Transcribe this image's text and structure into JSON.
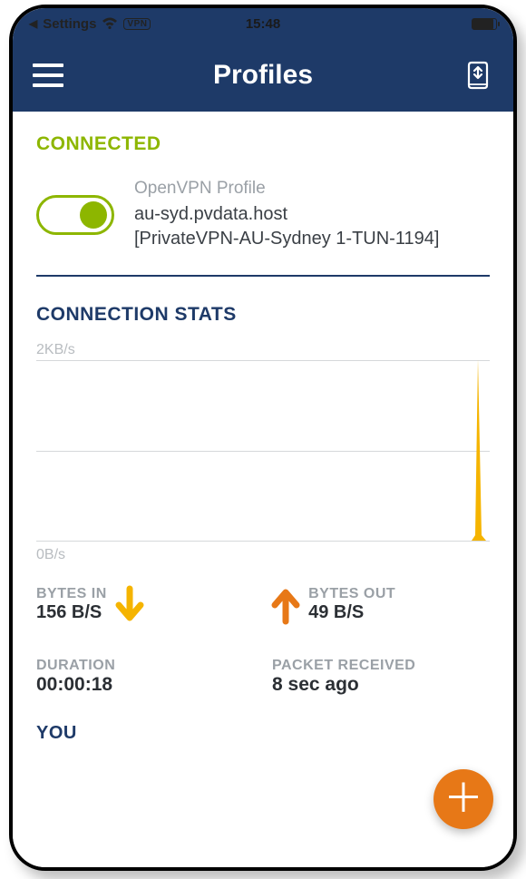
{
  "status": {
    "back_label": "Settings",
    "vpn_badge": "VPN",
    "time": "15:48"
  },
  "nav": {
    "title": "Profiles"
  },
  "connection": {
    "status_label": "CONNECTED",
    "profile_subtitle": "OpenVPN Profile",
    "profile_line1": "au-syd.pvdata.host",
    "profile_line2": "[PrivateVPN-AU-Sydney 1-TUN-1194]"
  },
  "stats": {
    "header": "CONNECTION STATS"
  },
  "chart_data": {
    "type": "area",
    "ylabel_top": "2KB/s",
    "ylabel_bottom": "0B/s",
    "ylim": [
      0,
      2048
    ],
    "series": [
      {
        "name": "bytes_in",
        "color": "#f5b400",
        "values": [
          0,
          0,
          0,
          0,
          0,
          0,
          0,
          0,
          0,
          0,
          0,
          0,
          0,
          0,
          0,
          0,
          0,
          0,
          0,
          0,
          0,
          0,
          0,
          0,
          0,
          0,
          0,
          0,
          0,
          0,
          0,
          0,
          0,
          0,
          0,
          0,
          0,
          0,
          0,
          0,
          0,
          0,
          0,
          0,
          0,
          0,
          0,
          0,
          0,
          0,
          0,
          0,
          0,
          0,
          0,
          0,
          0,
          0,
          60,
          2000
        ]
      }
    ]
  },
  "bytes": {
    "in_label": "BYTES IN",
    "in_value": "156 B/S",
    "out_label": "BYTES OUT",
    "out_value": "49 B/S"
  },
  "duration": {
    "label": "DURATION",
    "value": "00:00:18"
  },
  "packet": {
    "label": "PACKET RECEIVED",
    "value": "8 sec ago"
  },
  "you": {
    "label": "YOU"
  },
  "colors": {
    "primary": "#1e3a68",
    "accent_green": "#8db600",
    "accent_yellow": "#f5b400",
    "accent_orange": "#e77817"
  }
}
